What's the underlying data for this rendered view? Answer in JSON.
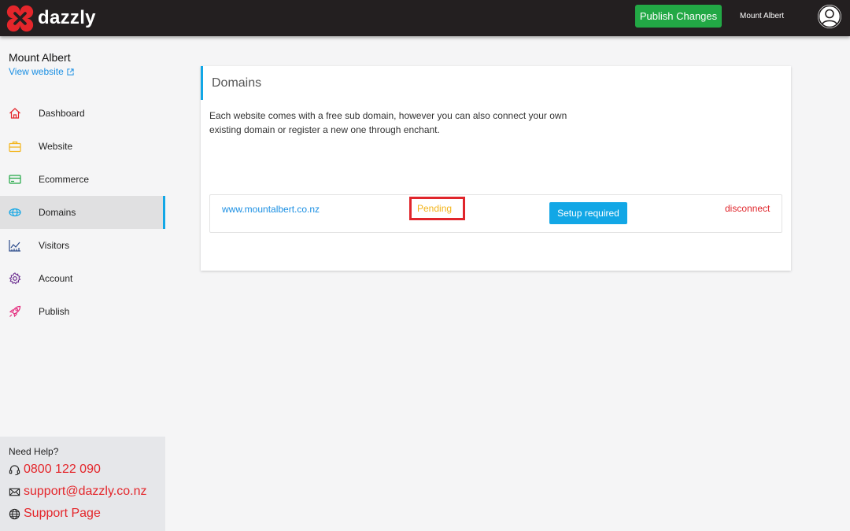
{
  "header": {
    "brand": "dazzly",
    "publish_label": "Publish Changes",
    "site_name": "Mount Albert",
    "brand_color": "#e4262b",
    "publish_color": "#22a845"
  },
  "sidebar": {
    "site_name": "Mount Albert",
    "view_website": "View website",
    "items": [
      {
        "label": "Dashboard",
        "icon": "home-icon",
        "color": "#e4262b"
      },
      {
        "label": "Website",
        "icon": "briefcase-icon",
        "color": "#f3b41a"
      },
      {
        "label": "Ecommerce",
        "icon": "card-icon",
        "color": "#22a845"
      },
      {
        "label": "Domains",
        "icon": "globe-icon",
        "color": "#12a7e6",
        "active": true
      },
      {
        "label": "Visitors",
        "icon": "chart-icon",
        "color": "#2b4a8a"
      },
      {
        "label": "Account",
        "icon": "gear-icon",
        "color": "#6a2c8f"
      },
      {
        "label": "Publish",
        "icon": "rocket-icon",
        "color": "#e4267a"
      }
    ],
    "help": {
      "title": "Need Help?",
      "phone": "0800 122 090",
      "email": "support@dazzly.co.nz",
      "support_page": "Support Page"
    }
  },
  "main": {
    "title": "Domains",
    "description": "Each website comes with a free sub domain, however you can also connect your own existing domain or register a new one through enchant.",
    "domains": [
      {
        "domain": "www.mountalbert.co.nz",
        "status": "Pending",
        "action_label": "Setup required",
        "disconnect_label": "disconnect"
      }
    ]
  }
}
